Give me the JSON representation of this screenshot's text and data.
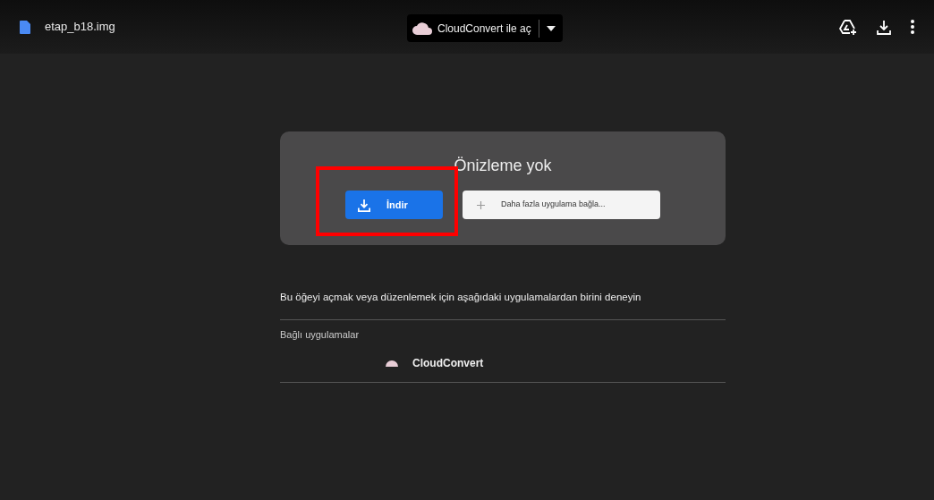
{
  "header": {
    "file_name": "etap_b18.img",
    "open_with": "CloudConvert ile aç"
  },
  "preview": {
    "title": "Önizleme yok",
    "buttons": [
      {
        "kind": "download",
        "label": "İndir",
        "highlighted": true
      },
      {
        "kind": "connect",
        "label": "Daha fazla uygulama bağla...",
        "highlighted": false
      }
    ]
  },
  "hint": "Bu öğeyi açmak veya düzenlemek için aşağıdaki uygulamalardan birini deneyin",
  "connected_apps": {
    "heading": "Bağlı uygulamalar",
    "apps": [
      "CloudConvert"
    ]
  }
}
